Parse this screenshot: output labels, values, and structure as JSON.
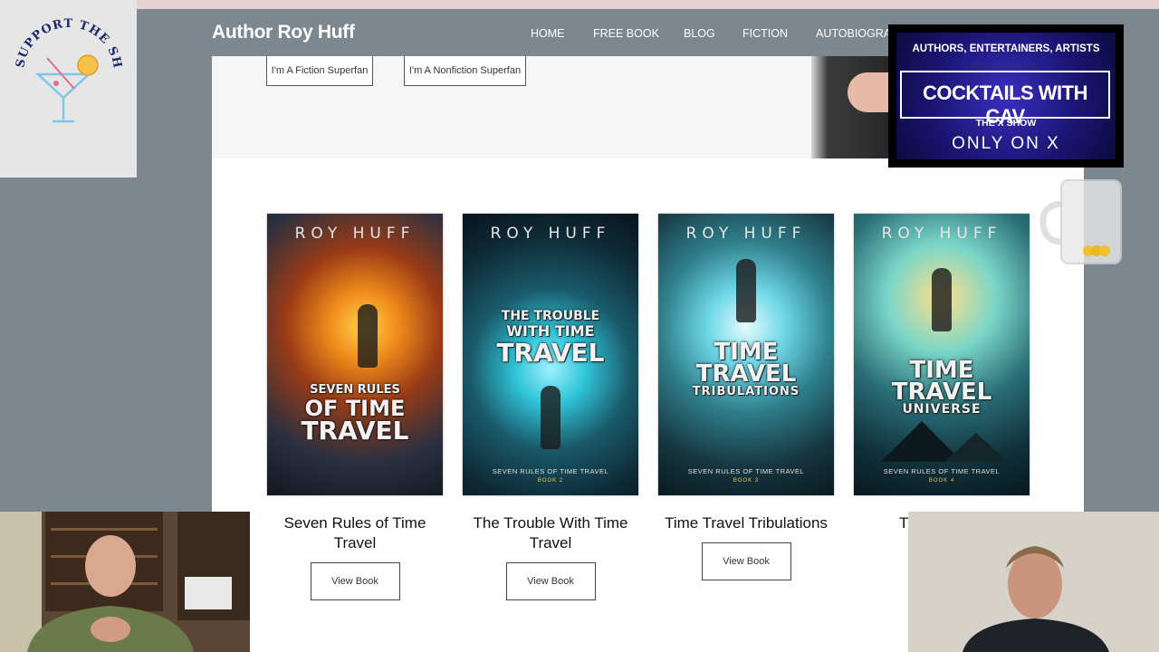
{
  "site": {
    "title": "Author Roy Huff",
    "nav": [
      "HOME",
      "FREE BOOK",
      "BLOG",
      "FICTION",
      "AUTOBIOGRA"
    ]
  },
  "hero": {
    "buttons": [
      "I'm A Fiction Superfan",
      "I'm A Nonfiction Superfan"
    ]
  },
  "books": [
    {
      "title": "Seven Rules of Time Travel",
      "button": "View Book",
      "cover": {
        "author": "ROY HUFF",
        "title_lines": [
          "SEVEN RULES",
          "OF TIME",
          "TRAVEL"
        ],
        "series": "",
        "number": ""
      }
    },
    {
      "title": "The Trouble With Time Travel",
      "button": "View Book",
      "cover": {
        "author": "ROY HUFF",
        "title_lines": [
          "THE TROUBLE",
          "WITH TIME",
          "TRAVEL"
        ],
        "series": "SEVEN RULES OF TIME TRAVEL",
        "number": "BOOK 2"
      }
    },
    {
      "title": "Time Travel Tribulations",
      "button": "View Book",
      "cover": {
        "author": "ROY HUFF",
        "title_lines": [
          "TIME",
          "TRAVEL",
          "TRIBULATIONS"
        ],
        "series": "SEVEN RULES OF TIME TRAVEL",
        "number": "BOOK 3"
      }
    },
    {
      "title": "T",
      "button": "",
      "cover": {
        "author": "ROY HUFF",
        "title_lines": [
          "TIME",
          "TRAVEL",
          "UNIVERSE"
        ],
        "series": "SEVEN RULES OF TIME TRAVEL",
        "number": "BOOK 4"
      }
    }
  ],
  "overlays": {
    "support": "SUPPORT THE SHOW",
    "promo_top": "AUTHORS, ENTERTAINERS, ARTISTS",
    "promo_main": "COCKTAILS WITH CAV",
    "promo_sub": "THE X SHOW",
    "promo_bottom": "ONLY ON X"
  },
  "colors": {
    "navbar": "#7d8790",
    "promo_blue": "#2a22a0",
    "accent_pink": "#e8d0d2"
  }
}
